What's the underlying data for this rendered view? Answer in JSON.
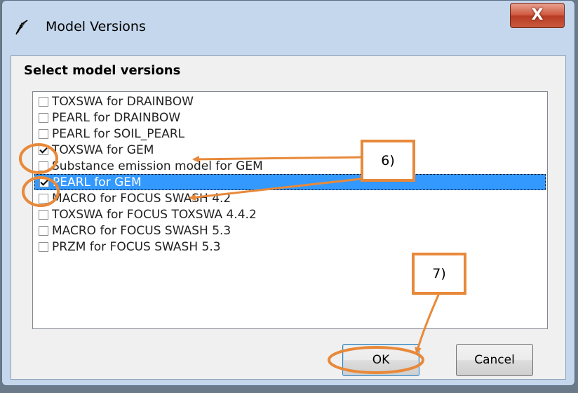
{
  "window": {
    "title": "Model Versions",
    "close_label": "X"
  },
  "dialog": {
    "heading": "Select model versions"
  },
  "versions": [
    {
      "label": "TOXSWA for DRAINBOW",
      "checked": false,
      "selected": false
    },
    {
      "label": "PEARL for DRAINBOW",
      "checked": false,
      "selected": false
    },
    {
      "label": "PEARL for SOIL_PEARL",
      "checked": false,
      "selected": false
    },
    {
      "label": "TOXSWA for GEM",
      "checked": true,
      "selected": false
    },
    {
      "label": "Substance emission model for GEM",
      "checked": false,
      "selected": false
    },
    {
      "label": "PEARL for GEM",
      "checked": true,
      "selected": true
    },
    {
      "label": "MACRO for FOCUS SWASH 4.2",
      "checked": false,
      "selected": false
    },
    {
      "label": "TOXSWA for FOCUS TOXSWA 4.4.2",
      "checked": false,
      "selected": false
    },
    {
      "label": "MACRO for FOCUS SWASH 5.3",
      "checked": false,
      "selected": false
    },
    {
      "label": "PRZM for FOCUS SWASH 5.3",
      "checked": false,
      "selected": false
    }
  ],
  "buttons": {
    "ok_label": "OK",
    "cancel_label": "Cancel"
  },
  "annotations": {
    "step6_label": "6)",
    "step7_label": "7)",
    "color": "#e8893a"
  },
  "colors": {
    "selection": "#3399ff",
    "close_button": "#c8492f",
    "window_frame": "#c4d7ec"
  }
}
